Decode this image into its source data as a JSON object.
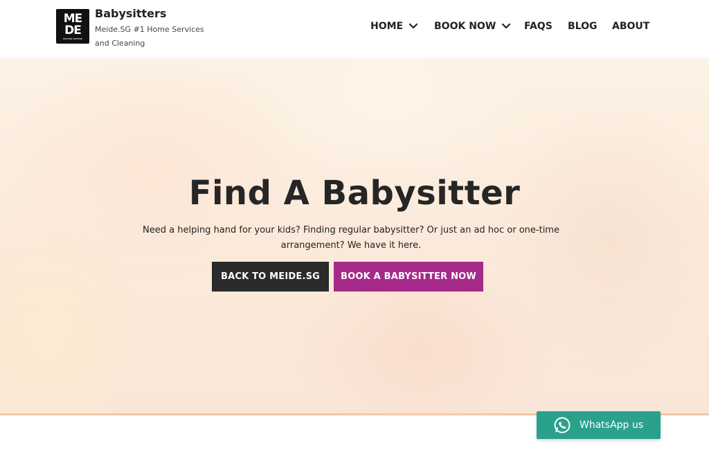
{
  "header": {
    "logo": {
      "line1": "ME",
      "line2": "DE",
      "line3": "MAISON SPHERE"
    },
    "site_title": "Babysitters",
    "tagline": "Meide.SG #1 Home Services and Cleaning"
  },
  "nav": {
    "items": [
      {
        "label": "HOME",
        "has_dropdown": true
      },
      {
        "label": "BOOK NOW",
        "has_dropdown": true
      },
      {
        "label": "FAQS",
        "has_dropdown": false
      },
      {
        "label": "BLOG",
        "has_dropdown": false
      },
      {
        "label": "ABOUT",
        "has_dropdown": false
      }
    ]
  },
  "hero": {
    "title": "Find A Babysitter",
    "description": "Need a helping hand for your kids? Finding regular babysitter? Or just an ad hoc or one-time arrangement? We have it here.",
    "buttons": {
      "back_label": "BACK TO MEIDE.SG",
      "book_label": "BOOK A BABYSITTER NOW"
    }
  },
  "whatsapp": {
    "label": "WhatsApp us",
    "icon": "whatsapp-icon"
  },
  "colors": {
    "primary_button": "#2b2b2b",
    "accent_button": "#a52a89",
    "whatsapp": "#2aa18b"
  }
}
